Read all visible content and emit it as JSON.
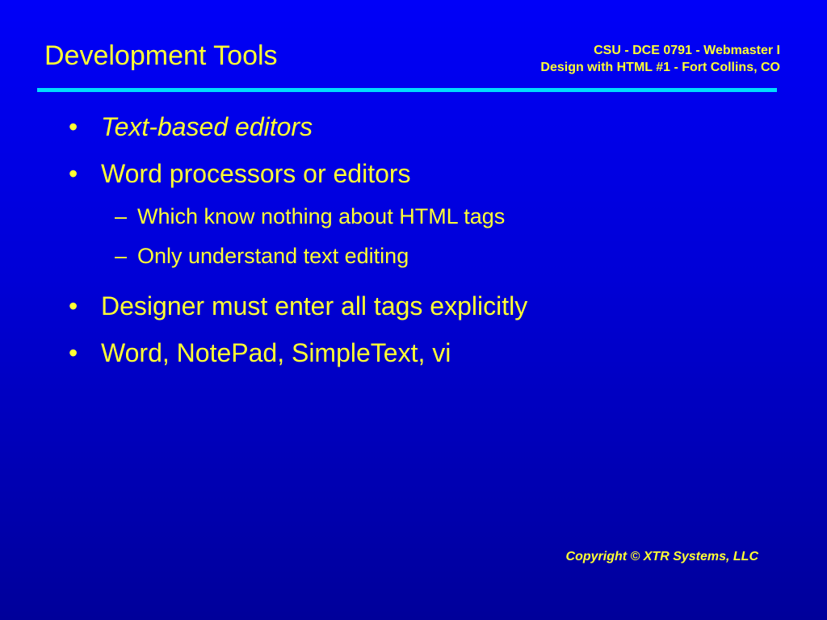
{
  "slide": {
    "title": "Development Tools",
    "header_line1": "CSU - DCE 0791 - Webmaster I",
    "header_line2": "Design with HTML #1 - Fort Collins, CO",
    "copyright": "Copyright © XTR Systems, LLC"
  },
  "bullets": [
    {
      "marker": "•",
      "text": "Text-based editors"
    },
    {
      "marker": "•",
      "text": "Word processors or editors"
    },
    {
      "marker": "–",
      "text": "Which know nothing about HTML tags"
    },
    {
      "marker": "–",
      "text": "Only understand text editing"
    },
    {
      "marker": "•",
      "text": "Designer must enter all tags explicitly"
    },
    {
      "marker": "•",
      "text": "Word, NotePad, SimpleText, vi"
    }
  ],
  "colors": {
    "text": "#FFFF33",
    "rule": "#00DDFF",
    "background_top": "#0000F8",
    "background_bottom": "#00009A"
  }
}
